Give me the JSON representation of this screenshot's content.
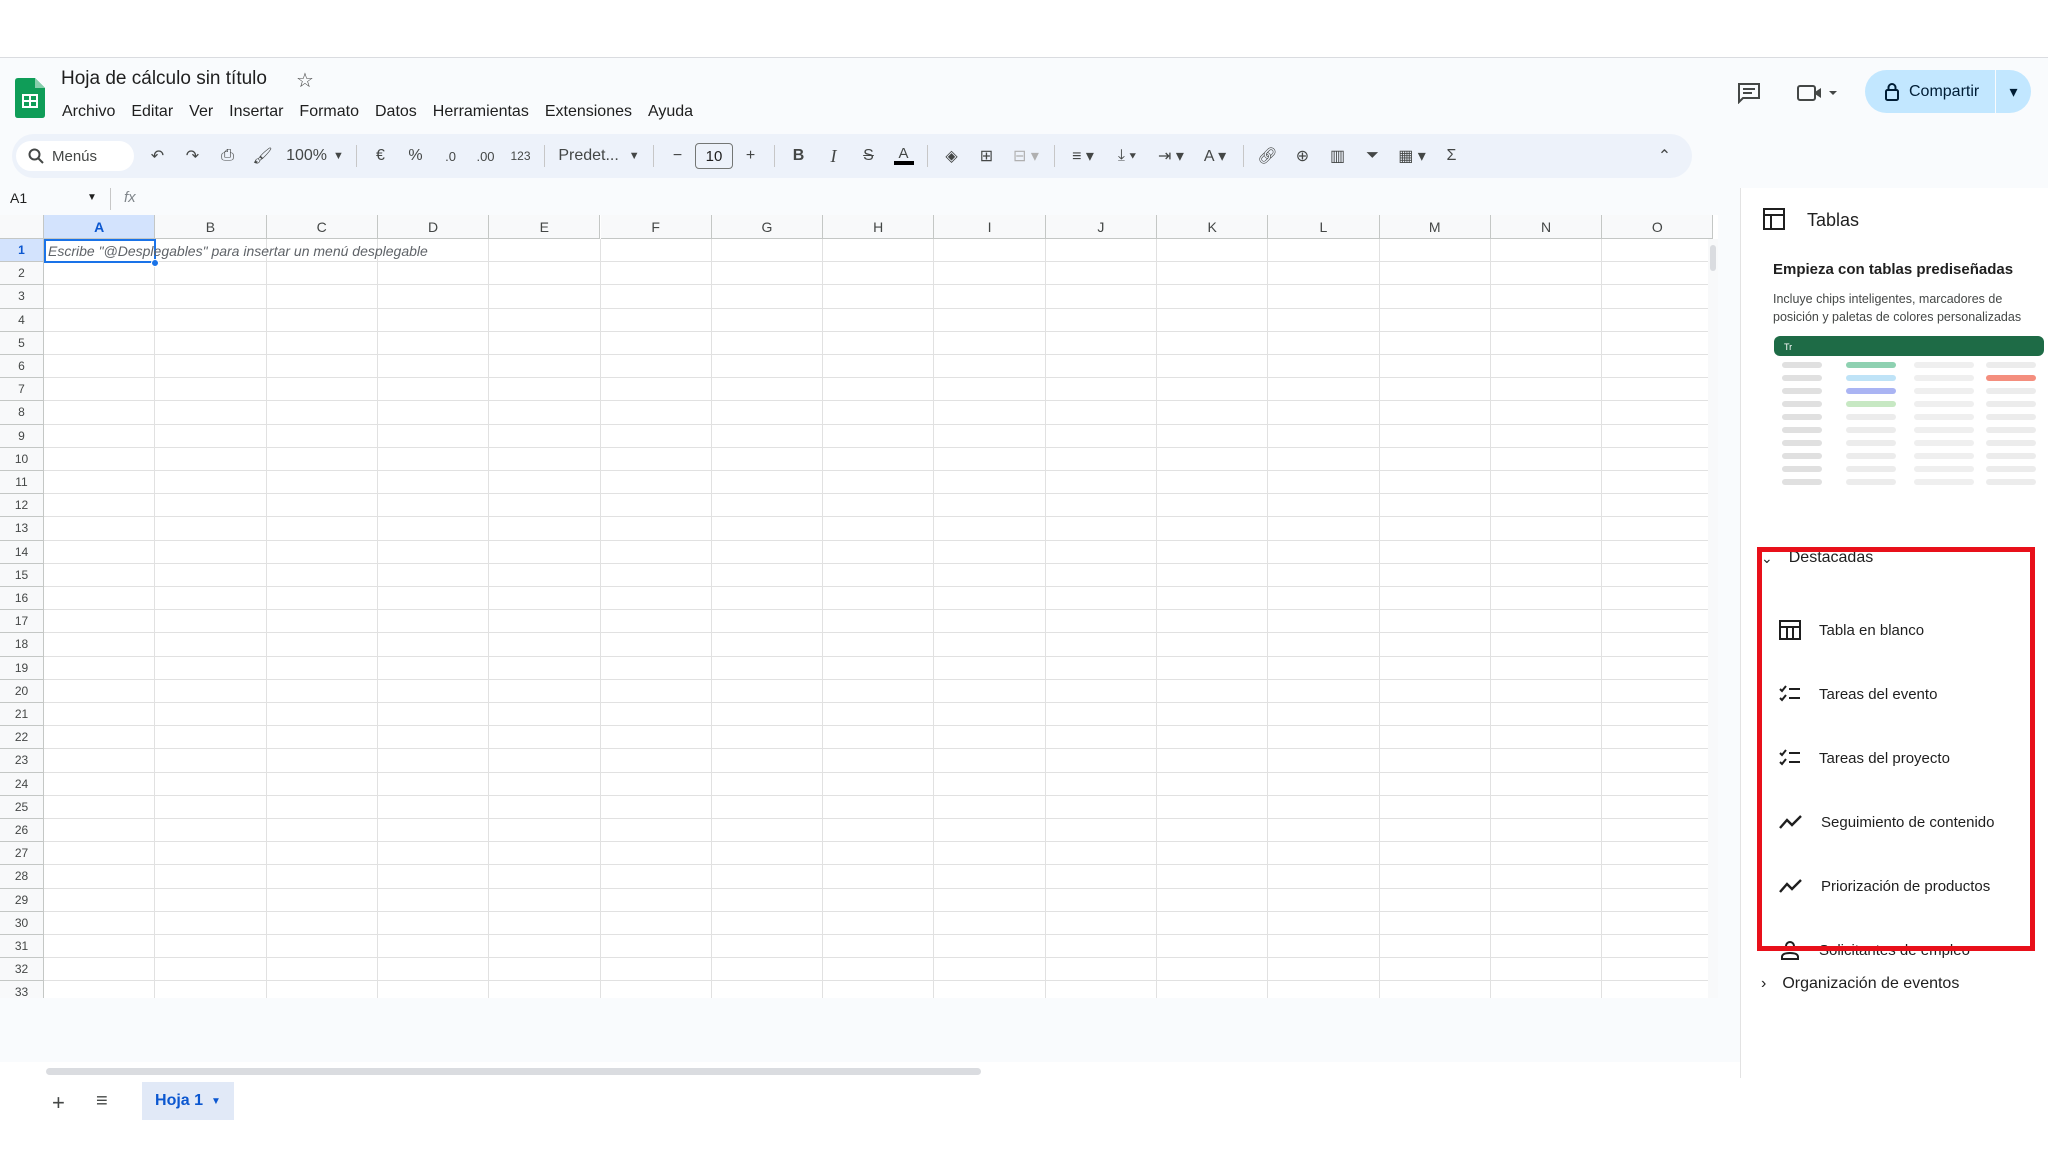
{
  "app": {
    "doc_title": "Hoja de cálculo sin título",
    "share_label": "Compartir",
    "accent": "#0b57d0",
    "share_bg": "#c2e7ff"
  },
  "menu": [
    "Archivo",
    "Editar",
    "Ver",
    "Insertar",
    "Formato",
    "Datos",
    "Herramientas",
    "Extensiones",
    "Ayuda"
  ],
  "toolbar": {
    "search_label": "Menús",
    "zoom": "100%",
    "currency": "€",
    "percent": "%",
    "dec_minus": ".0",
    "dec_plus": ".00",
    "format_123": "123",
    "font": "Predet...",
    "font_size": "10",
    "bold": "B",
    "italic": "I",
    "sum": "Σ"
  },
  "formula_bar": {
    "cell_ref": "A1",
    "fx": "fx"
  },
  "grid": {
    "columns": [
      "A",
      "B",
      "C",
      "D",
      "E",
      "F",
      "G",
      "H",
      "I",
      "J",
      "K",
      "L",
      "M",
      "N",
      "O"
    ],
    "rows": [
      "1",
      "2",
      "3",
      "4",
      "5",
      "6",
      "7",
      "8",
      "9",
      "10",
      "11",
      "12",
      "13",
      "14",
      "15",
      "16",
      "17",
      "18",
      "19",
      "20",
      "21",
      "22",
      "23",
      "24",
      "25",
      "26",
      "27",
      "28",
      "29",
      "30",
      "31",
      "32",
      "33"
    ],
    "selected_col": "A",
    "selected_row": "1",
    "hint": "Escribe \"@Desplegables\" para insertar un menú desplegable"
  },
  "sheets": {
    "tabs": [
      "Hoja 1"
    ]
  },
  "panel": {
    "title": "Tablas",
    "heading": "Empieza con tablas prediseñadas",
    "description": "Incluye chips inteligentes, marcadores de posición y paletas de colores personalizadas",
    "featured_label": "Destacadas",
    "items": [
      {
        "label": "Tabla en blanco",
        "icon": "table-icon"
      },
      {
        "label": "Tareas del evento",
        "icon": "checklist-icon"
      },
      {
        "label": "Tareas del proyecto",
        "icon": "checklist-icon"
      },
      {
        "label": "Seguimiento de contenido",
        "icon": "trending-icon"
      },
      {
        "label": "Priorización de productos",
        "icon": "trending-icon"
      },
      {
        "label": "Solicitantes de empleo",
        "icon": "person-icon"
      }
    ],
    "next_section_label": "Organización de eventos",
    "highlight_color": "#e8101a"
  }
}
